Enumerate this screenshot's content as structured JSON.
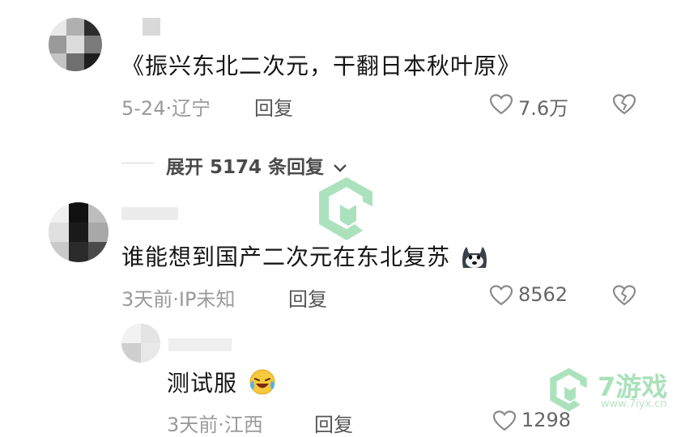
{
  "colors": {
    "text_primary": "#161616",
    "text_meta": "#9a9a9a",
    "icon_gray": "#8a8a8a",
    "watermark_green": "#8fd9a8"
  },
  "comments": [
    {
      "text": "《振兴东北二次元，干翻日本秋叶原》",
      "date": "5-24",
      "location": "辽宁",
      "reply_label": "回复",
      "likes": "7.6万",
      "expand_label": "展开 5174 条回复"
    },
    {
      "text": "谁能想到国产二次元在东北复苏",
      "emoji": "doge-emoji",
      "date": "3天前",
      "location": "IP未知",
      "reply_label": "回复",
      "likes": "8562"
    },
    {
      "text": "测试服",
      "emoji": "laughing-crying-emoji",
      "date": "3天前",
      "location": "江西",
      "reply_label": "回复",
      "likes": "1298"
    }
  ],
  "watermark": {
    "brand": "7游戏",
    "url": "www.7iyx.cn"
  }
}
